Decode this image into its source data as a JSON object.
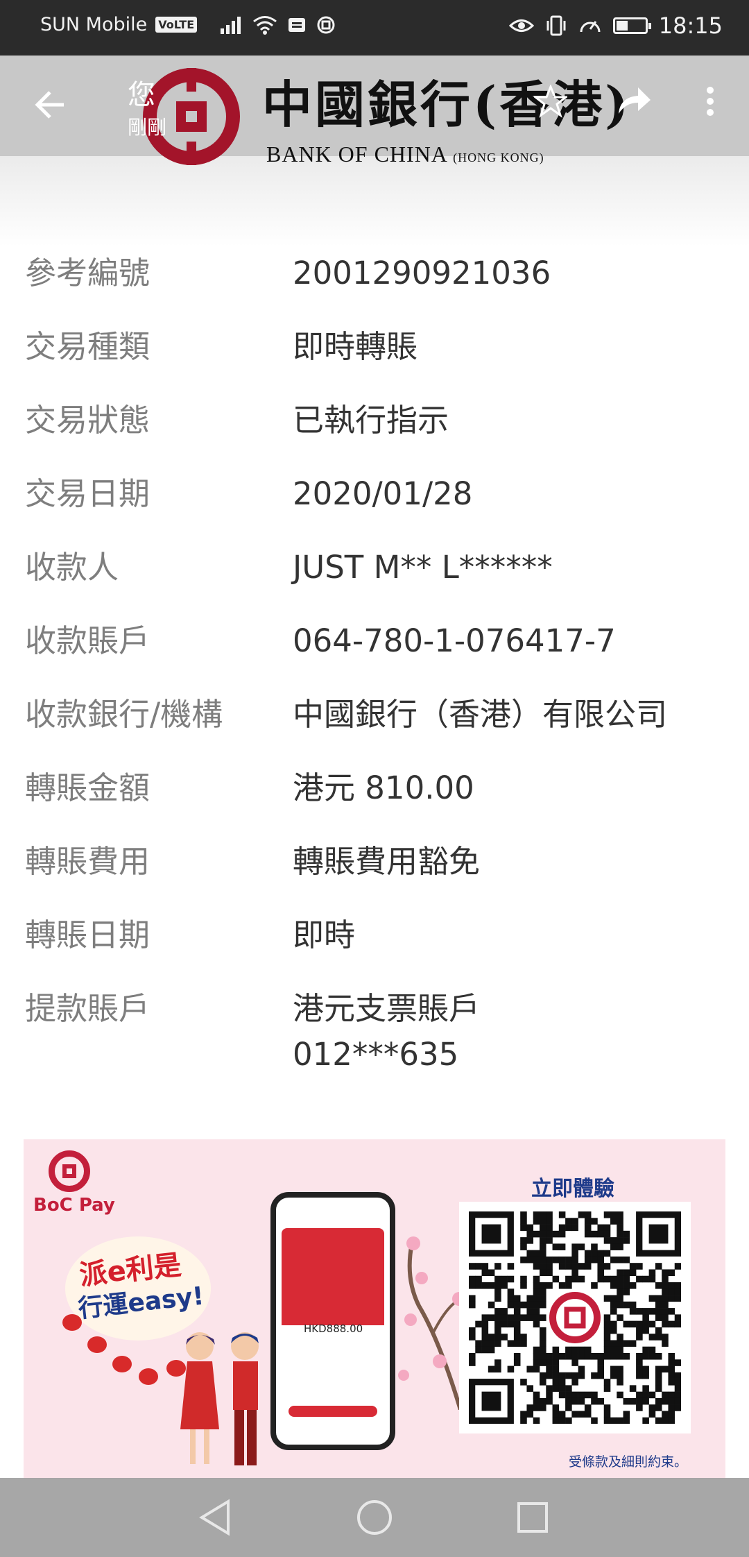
{
  "status_bar": {
    "carrier": "SUN Mobile",
    "network_badge": "VoLTE",
    "time": "18:15",
    "battery_percent": 40
  },
  "header": {
    "sender_name": "您",
    "sender_time": "剛剛",
    "logo_chinese": "中國銀行(香港)",
    "logo_english": "BANK OF CHINA",
    "logo_english_sub": "(HONG KONG)",
    "brand_color": "#a3142a",
    "icons": [
      "back-arrow-icon",
      "star-icon",
      "share-icon",
      "more-vert-icon"
    ]
  },
  "details": [
    {
      "label": "參考編號",
      "value": "2001290921036"
    },
    {
      "label": "交易種類",
      "value": "即時轉賬"
    },
    {
      "label": "交易狀態",
      "value": "已執行指示"
    },
    {
      "label": "交易日期",
      "value": "2020/01/28"
    },
    {
      "label": "收款人",
      "value": "JUST M** L******"
    },
    {
      "label": "收款賬戶",
      "value": "064-780-1-076417-7"
    },
    {
      "label": "收款銀行/機構",
      "value": "中國銀行（香港）有限公司"
    },
    {
      "label": "轉賬金額",
      "value": "港元 810.00"
    },
    {
      "label": "轉賬費用",
      "value": "轉賬費用豁免"
    },
    {
      "label": "轉賬日期",
      "value": "即時"
    },
    {
      "label": "提款賬戶",
      "value": "港元支票賬戶",
      "value_line2": "012***635"
    }
  ],
  "banner": {
    "brand": "BoC Pay",
    "slogan_line1": "派e利是",
    "slogan_line2": "行運easy!",
    "phone_amount": "HKD888.00",
    "cta": "立即體驗",
    "terms": "受條款及細則約束。"
  },
  "nav_bar": {
    "icons": [
      "back-triangle-icon",
      "home-circle-icon",
      "recents-square-icon"
    ]
  }
}
